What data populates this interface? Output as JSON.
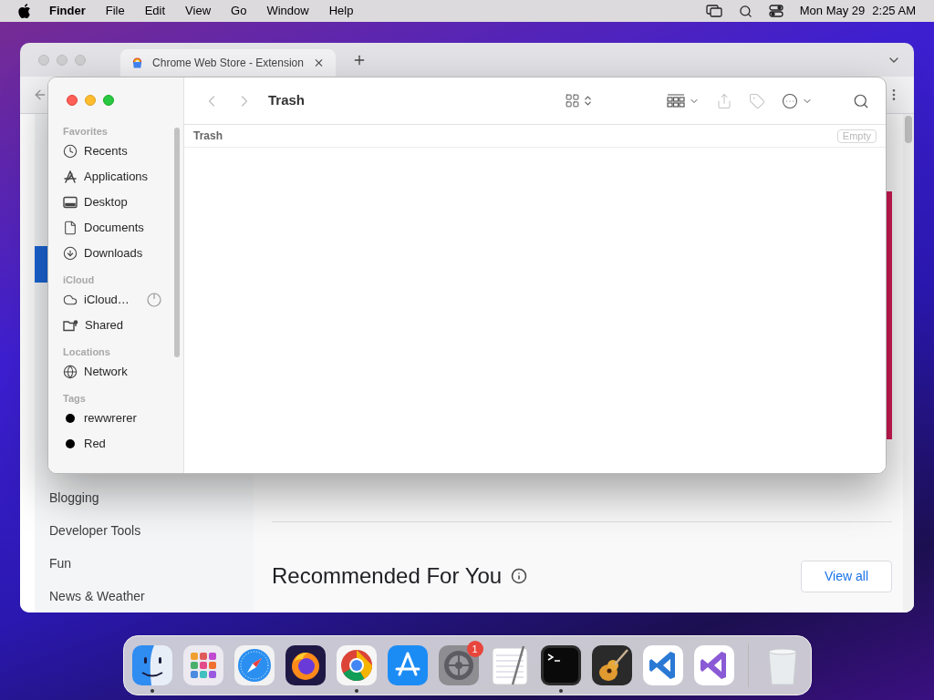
{
  "menu_bar": {
    "app": "Finder",
    "menus": [
      "File",
      "Edit",
      "View",
      "Go",
      "Window",
      "Help"
    ],
    "date": "Mon May 29",
    "time": "2:25 AM"
  },
  "browser": {
    "tab_title": "Chrome Web Store - Extension",
    "categories": [
      "Blogging",
      "Developer Tools",
      "Fun",
      "News & Weather"
    ],
    "section_title": "Recommended For You",
    "view_all": "View all"
  },
  "finder": {
    "title": "Trash",
    "path": "Trash",
    "empty_button": "Empty",
    "sidebar": [
      {
        "header": "Favorites",
        "items": [
          {
            "kind": "recents",
            "label": "Recents"
          },
          {
            "kind": "applications",
            "label": "Applications"
          },
          {
            "kind": "desktop",
            "label": "Desktop"
          },
          {
            "kind": "documents",
            "label": "Documents"
          },
          {
            "kind": "downloads",
            "label": "Downloads"
          }
        ]
      },
      {
        "header": "iCloud",
        "items": [
          {
            "kind": "icloud",
            "label": "iCloud…",
            "syncing": true
          },
          {
            "kind": "shared",
            "label": "Shared"
          }
        ]
      },
      {
        "header": "Locations",
        "items": [
          {
            "kind": "network",
            "label": "Network"
          }
        ]
      },
      {
        "header": "Tags",
        "items": [
          {
            "kind": "tag",
            "label": "rewwrerer",
            "color": "#000000"
          },
          {
            "kind": "tag",
            "label": "Red",
            "color": "#000000"
          }
        ]
      }
    ]
  },
  "dock": [
    {
      "kind": "finder",
      "running": true
    },
    {
      "kind": "launchpad",
      "running": false
    },
    {
      "kind": "safari",
      "running": false
    },
    {
      "kind": "firefox",
      "running": false
    },
    {
      "kind": "chrome",
      "running": true
    },
    {
      "kind": "appstore",
      "running": false
    },
    {
      "kind": "settings",
      "running": false,
      "badge": "1"
    },
    {
      "kind": "textedit",
      "running": false
    },
    {
      "kind": "terminal",
      "running": true
    },
    {
      "kind": "garageband",
      "running": false
    },
    {
      "kind": "vscode",
      "running": false
    },
    {
      "kind": "visualstudio",
      "running": false
    },
    {
      "kind": "trash",
      "running": false
    }
  ]
}
